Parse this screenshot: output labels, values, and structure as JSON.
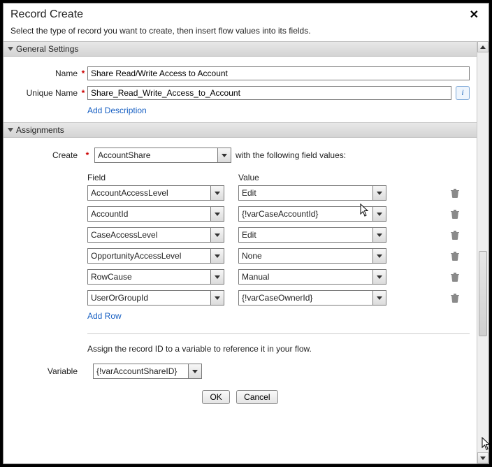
{
  "dialog": {
    "title": "Record Create",
    "subtitle": "Select the type of record you want to create, then insert flow values into its fields."
  },
  "general": {
    "section_title": "General Settings",
    "name_label": "Name",
    "name_value": "Share Read/Write Access to Account",
    "unique_label": "Unique Name",
    "unique_value": "Share_Read_Write_Access_to_Account",
    "add_description": "Add Description"
  },
  "assignments": {
    "section_title": "Assignments",
    "create_label": "Create",
    "create_value": "AccountShare",
    "create_suffix": "with the following field values:",
    "field_header": "Field",
    "value_header": "Value",
    "rows": [
      {
        "field": "AccountAccessLevel",
        "value": "Edit"
      },
      {
        "field": "AccountId",
        "value": "{!varCaseAccountId}"
      },
      {
        "field": "CaseAccessLevel",
        "value": "Edit"
      },
      {
        "field": "OpportunityAccessLevel",
        "value": "None"
      },
      {
        "field": "RowCause",
        "value": "Manual"
      },
      {
        "field": "UserOrGroupId",
        "value": "{!varCaseOwnerId}"
      }
    ],
    "add_row": "Add Row",
    "assign_hint": "Assign the record ID to a variable to reference it in your flow.",
    "variable_label": "Variable",
    "variable_value": "{!varAccountShareID}"
  },
  "buttons": {
    "ok": "OK",
    "cancel": "Cancel"
  }
}
